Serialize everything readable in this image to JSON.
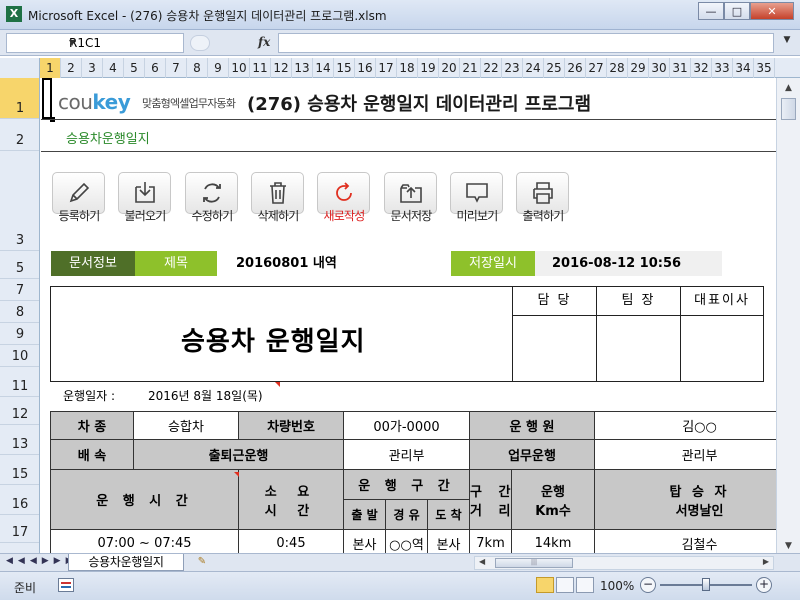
{
  "window": {
    "title": "Microsoft Excel - (276) 승용차 운행일지 데이터관리 프로그램.xlsm",
    "app_icon_letter": "X",
    "min": "—",
    "max": "□",
    "close": "✕"
  },
  "formula_bar": {
    "name_box": "R1C1",
    "fx": "fx",
    "value": ""
  },
  "columns": [
    "1",
    "2",
    "3",
    "4",
    "5",
    "6",
    "7",
    "8",
    "9",
    "10",
    "11",
    "12",
    "13",
    "14",
    "15",
    "16",
    "17",
    "18",
    "19",
    "20",
    "21",
    "22",
    "23",
    "24",
    "25",
    "26",
    "27",
    "28",
    "29",
    "30",
    "31",
    "32",
    "33",
    "34",
    "35"
  ],
  "rows": [
    "1",
    "2",
    "3",
    "5",
    "7",
    "8",
    "9",
    "10",
    "11",
    "12",
    "13",
    "15",
    "16",
    "17"
  ],
  "header": {
    "logo_prefix": "cou",
    "logo_suffix": "key",
    "logo_tagline": "맞춤형엑셀업무자동화",
    "program_title": "(276) 승용차 운행일지 데이터관리 프로그램",
    "subtitle": "승용차운행일지"
  },
  "toolbar": [
    {
      "label": "등록하기",
      "icon": "pencil-icon"
    },
    {
      "label": "불러오기",
      "icon": "download-icon"
    },
    {
      "label": "수정하기",
      "icon": "refresh-icon"
    },
    {
      "label": "삭제하기",
      "icon": "trash-icon"
    },
    {
      "label": "새로작성",
      "icon": "new-icon"
    },
    {
      "label": "문서저장",
      "icon": "save-folder-icon"
    },
    {
      "label": "미리보기",
      "icon": "preview-icon"
    },
    {
      "label": "출력하기",
      "icon": "printer-icon"
    }
  ],
  "doc_info": {
    "section_label": "문서정보",
    "title_label": "제목",
    "title_value": "20160801 내역",
    "saved_label": "저장일시",
    "saved_value": "2016-08-12 10:56"
  },
  "form": {
    "title": "승용차 운행일지",
    "approvals": [
      "담 당",
      "팀 장",
      "대표이사"
    ],
    "run_date_label": "운행일자 :",
    "run_date_value": "2016년 8월 18일(목)"
  },
  "table": {
    "car_type_label": "차 종",
    "car_type_value": "승합차",
    "car_no_label": "차량번호",
    "car_no_value": "00가-0000",
    "driver_label": "운 행 원",
    "driver_value": "김○○",
    "dept_label": "배 속",
    "purpose_value": "출퇴근운행",
    "dept_value": "관리부",
    "work_label": "업무운행",
    "work_value": "관리부",
    "col_time": "운 행 시 간",
    "col_duration_1": "소 요",
    "col_duration_2": "시 간",
    "col_section": "운 행 구 간",
    "col_depart": "출 발",
    "col_via": "경 유",
    "col_arrive": "도 착",
    "col_distance_1": "구 간",
    "col_distance_2": "거 리",
    "col_km_1": "운행",
    "col_km_2": "Km수",
    "col_sign_1": "탑 승 자",
    "col_sign_2": "서명날인",
    "row1": {
      "time": "07:00 ~ 07:45",
      "duration": "0:45",
      "depart": "본사",
      "via": "○○역",
      "arrive": "본사",
      "distance": "7km",
      "km": "14km",
      "signer": "김철수"
    }
  },
  "sheet_tabs": {
    "active": "승용차운행일지"
  },
  "status": {
    "ready": "준비",
    "zoom": "100%"
  }
}
